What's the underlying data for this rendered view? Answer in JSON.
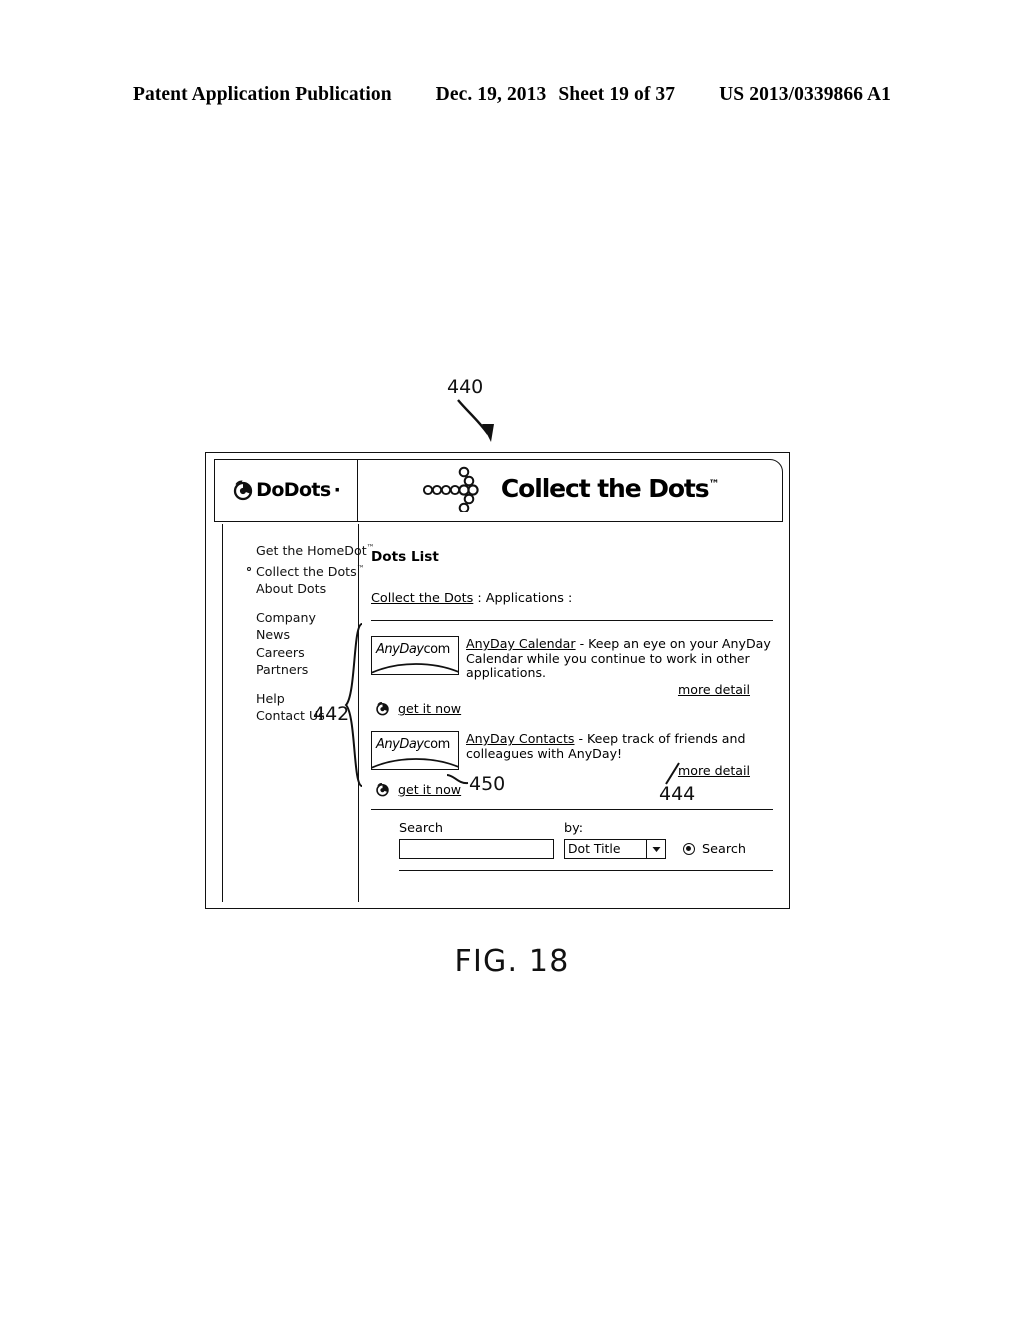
{
  "patent_header": {
    "publication": "Patent Application Publication",
    "date": "Dec. 19, 2013",
    "sheet": "Sheet 19 of 37",
    "number": "US 2013/0339866 A1"
  },
  "figure": {
    "caption": "FIG. 18",
    "callouts": {
      "window": "440",
      "dot_list_group": "442",
      "more_detail": "444",
      "get_it_now": "450"
    }
  },
  "window": {
    "logo": {
      "word": "DoDots",
      "tick": "·",
      "mark_icon": "dodots-circle-icon"
    },
    "banner": {
      "title": "Collect the Dots",
      "tm": "™",
      "dots_icon": "dot-cluster-icon"
    },
    "sidebar": {
      "groups": [
        {
          "items": [
            {
              "label": "Get the HomeDot",
              "tm": "™",
              "selected": false
            },
            {
              "label": "Collect the Dots",
              "tm": "™",
              "selected": true
            },
            {
              "label": "About Dots",
              "tm": "",
              "selected": false
            }
          ]
        },
        {
          "items": [
            {
              "label": "Company",
              "tm": "",
              "selected": false
            },
            {
              "label": "News",
              "tm": "",
              "selected": false
            },
            {
              "label": "Careers",
              "tm": "",
              "selected": false
            },
            {
              "label": "Partners",
              "tm": "",
              "selected": false
            }
          ]
        },
        {
          "items": [
            {
              "label": "Help",
              "tm": "",
              "selected": false
            },
            {
              "label": "Contact Us",
              "tm": "",
              "selected": false
            }
          ]
        }
      ]
    },
    "content": {
      "page_title": "Dots List",
      "breadcrumb": {
        "link": "Collect the Dots",
        "tail": " : Applications :"
      },
      "dots": [
        {
          "logo_italic": "AnyDay",
          "logo_plain": "com",
          "title": "AnyDay Calendar",
          "description": " - Keep an eye on your AnyDay Calendar while you continue to work in other applications.",
          "more_detail": "more detail",
          "get_it_now": "get it now"
        },
        {
          "logo_italic": "AnyDay",
          "logo_plain": "com",
          "title": "AnyDay Contacts",
          "description": " - Keep track of friends and colleagues with AnyDay!",
          "more_detail": "more detail",
          "get_it_now": "get it now"
        }
      ],
      "search": {
        "label": "Search",
        "by_label": "by:",
        "input_value": "",
        "input_placeholder": "",
        "select_value": "Dot Title",
        "select_options": [
          "Dot Title"
        ],
        "radio_label": "Search",
        "radio_selected": true
      }
    }
  }
}
